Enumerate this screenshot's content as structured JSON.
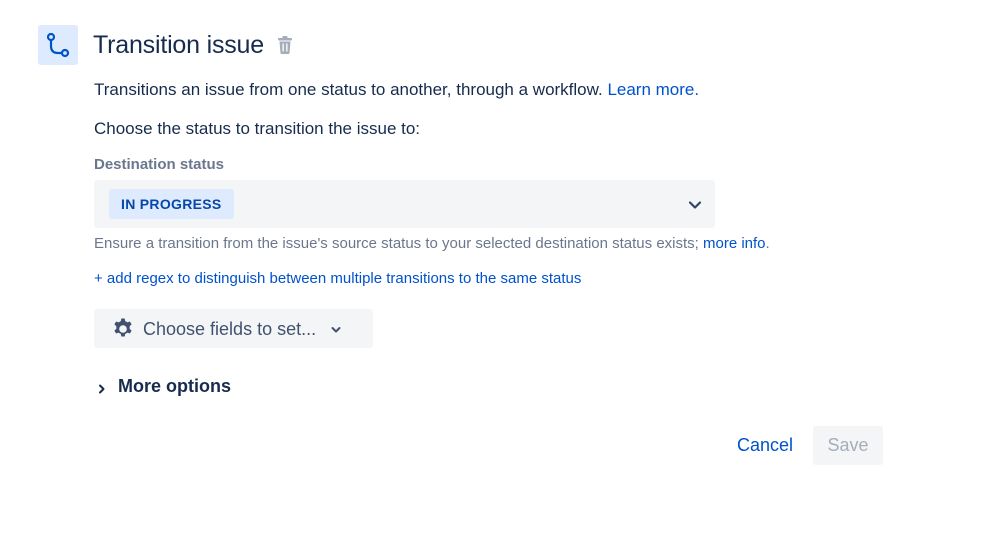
{
  "header": {
    "icon": "transition-icon",
    "title": "Transition issue",
    "delete_icon": "trash-icon"
  },
  "description": {
    "text": "Transitions an issue from one status to another, through a workflow.",
    "link": "Learn more."
  },
  "prompt": "Choose the status to transition the issue to:",
  "destination": {
    "label": "Destination status",
    "selected": "IN PROGRESS",
    "dropdown_icon": "chevron-down-icon"
  },
  "helper": {
    "text": "Ensure a transition from the issue's source status to your selected destination status exists;",
    "link": "more info",
    "suffix": "."
  },
  "add_regex": "+ add regex to distinguish between multiple transitions to the same status",
  "fields_button": {
    "icon": "gear-icon",
    "label": "Choose fields to set...",
    "chevron": "chevron-down-icon"
  },
  "more_options": {
    "icon": "chevron-right-icon",
    "label": "More options"
  },
  "actions": {
    "cancel": "Cancel",
    "save": "Save"
  },
  "colors": {
    "link": "#0052cc",
    "lozenge_bg": "#deebff",
    "lozenge_text": "#0747a6",
    "field_bg": "#f4f5f7",
    "text_primary": "#172b4d",
    "text_subtle": "#6b778c",
    "disabled_text": "#a5adba"
  }
}
